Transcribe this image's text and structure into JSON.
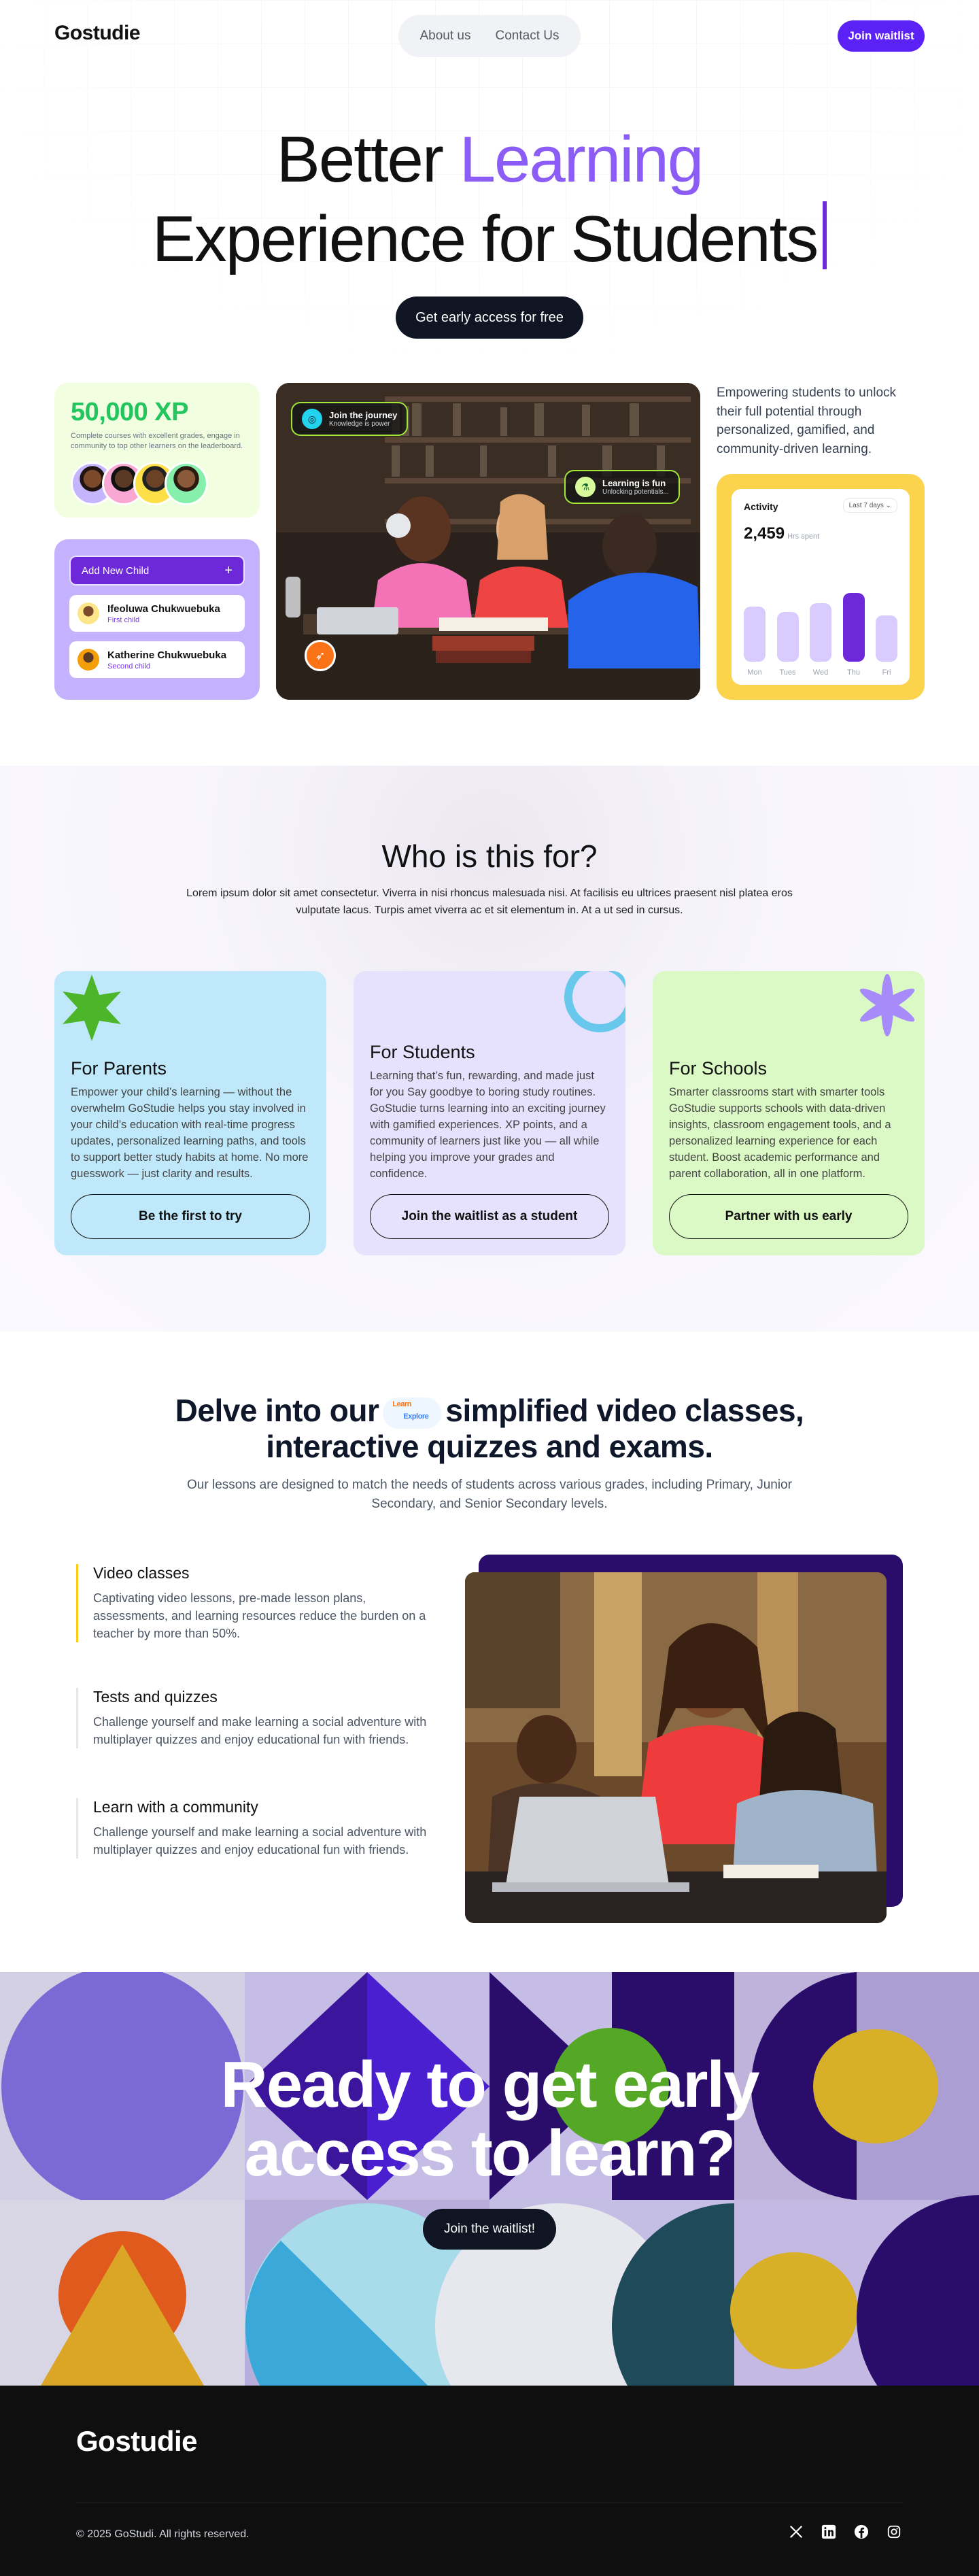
{
  "header": {
    "logo": "Gostudie",
    "nav": [
      "About us",
      "Contact Us"
    ],
    "cta": "Join waitlist"
  },
  "hero": {
    "line1_part1": "Better",
    "line1_accent": "Learning",
    "line2": "Experience for Students",
    "cta": "Get early access for free"
  },
  "xp_card": {
    "value": "50,000 XP",
    "description": "Complete courses with excellent grades, engage in community to top other learners on the leaderboard."
  },
  "child_card": {
    "add_label": "Add New Child",
    "children": [
      {
        "name": "Ifeoluwa Chukwuebuka",
        "role": "First child"
      },
      {
        "name": "Katherine Chukwuebuka",
        "role": "Second child"
      }
    ]
  },
  "photo_pills": [
    {
      "title": "Join the journey",
      "subtitle": "Knowledge is power"
    },
    {
      "title": "Learning is fun",
      "subtitle": "Unlocking potentials..."
    }
  ],
  "empower_text": "Empowering students to unlock their full potential through personalized, gamified, and community-driven learning.",
  "activity": {
    "title": "Activity",
    "range": "Last 7 days",
    "value": "2,459",
    "unit": "Hrs spent",
    "days": [
      "Mon",
      "Tues",
      "Wed",
      "Thu",
      "Fri"
    ],
    "levels": [
      0.62,
      0.56,
      0.66,
      0.78,
      0.52
    ],
    "highlight_index": 3
  },
  "who": {
    "heading": "Who is this for?",
    "text": "Lorem ipsum dolor sit amet consectetur. Viverra in nisi rhoncus malesuada nisi. At facilisis eu ultrices praesent nisl platea eros vulputate lacus. Turpis amet viverra ac et sit elementum in. At a ut sed in cursus.",
    "cards": [
      {
        "title": "For Parents",
        "text": "Empower your child’s learning — without the overwhelm GoStudie helps you stay involved in your child’s education with real-time progress updates, personalized learning paths, and tools to support better study habits at home. No more guesswork — just clarity and results.",
        "button": "Be the first to try",
        "bg": "#bfe9fb"
      },
      {
        "title": "For Students",
        "text": "Learning that’s fun, rewarding, and made just for you Say goodbye to boring study routines. GoStudie turns learning into an exciting journey with gamified experiences. XP points, and a community of learners just like you — all while helping you improve your grades and confidence.",
        "button": "Join the waitlist as a student",
        "bg": "#e6e1fc"
      },
      {
        "title": "For Schools",
        "text": "Smarter classrooms start with smarter tools GoStudie supports schools with data-driven insights, classroom engagement tools, and a personalized learning experience for each student. Boost academic performance and parent collaboration, all in one platform.",
        "button": "Partner with us early",
        "bg": "#dbf9c4"
      }
    ]
  },
  "delve": {
    "heading_part1": "Delve into our",
    "chip_top": "Learn",
    "chip_bottom": "Explore",
    "heading_part2": "simplified video classes,",
    "heading_line2": "interactive quizzes and exams.",
    "text": "Our lessons are designed to match the needs of students across various grades, including Primary, Junior Secondary, and Senior Secondary levels.",
    "features": [
      {
        "title": "Video classes",
        "text": "Captivating video lessons, pre-made lesson plans, assessments, and learning resources reduce the burden on a teacher by more than 50%."
      },
      {
        "title": "Tests and quizzes",
        "text": "Challenge yourself and make learning a social adventure with multiplayer quizzes and enjoy educational fun with friends."
      },
      {
        "title": "Learn with a community",
        "text": "Challenge yourself and make learning a social adventure with multiplayer quizzes and enjoy educational fun with friends."
      }
    ]
  },
  "cta": {
    "line1": "Ready to get early",
    "line2": "access to learn?",
    "button": "Join the waitlist!"
  },
  "footer": {
    "logo": "Gostudie",
    "copyright": "© 2025 GoStudi. All rights reserved.",
    "socials": [
      "x-icon",
      "linkedin-icon",
      "facebook-icon",
      "instagram-icon"
    ]
  }
}
